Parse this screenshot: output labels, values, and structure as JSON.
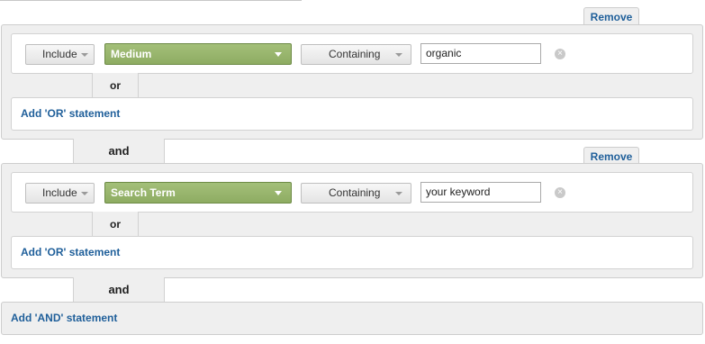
{
  "groups": [
    {
      "remove_label": "Remove",
      "include_label": "Include",
      "dimension": "Medium",
      "match_label": "Containing",
      "value": "organic",
      "or_label": "or",
      "add_or_label": "Add 'OR' statement"
    },
    {
      "remove_label": "Remove",
      "include_label": "Include",
      "dimension": "Search Term",
      "match_label": "Containing",
      "value": "your keyword",
      "or_label": "or",
      "add_or_label": "Add 'OR' statement"
    }
  ],
  "and_label": "and",
  "add_and_label": "Add 'AND' statement",
  "colors": {
    "dimension_green": "#98b46b",
    "link_blue": "#1f5f9a",
    "panel_grey": "#efefef"
  }
}
